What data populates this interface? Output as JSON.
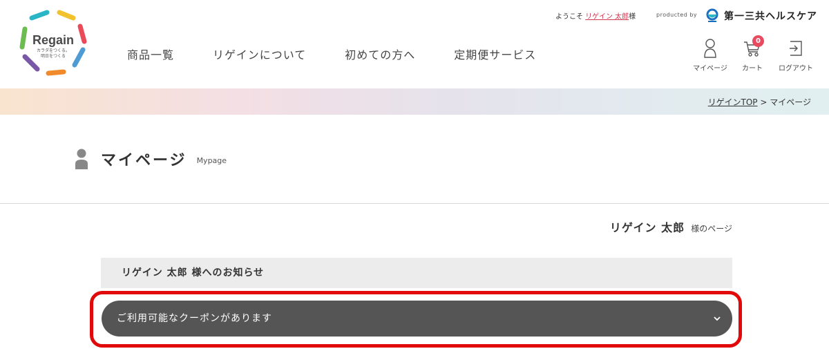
{
  "logo": {
    "name": "Regain",
    "tagline_1": "カラダをつくる。",
    "tagline_2": "明日をつくる",
    "colors": [
      "#2bb6c8",
      "#f2c12e",
      "#e94b59",
      "#f08a2a",
      "#7a58a8",
      "#4f9bd3",
      "#6cbc4f"
    ]
  },
  "header": {
    "welcome_prefix": "ようこそ",
    "welcome_user": "リゲイン 太郎",
    "welcome_suffix": "様",
    "produced_by": "producted by",
    "brand_name": "第一三共ヘルスケア"
  },
  "nav": {
    "items": [
      "商品一覧",
      "リゲインについて",
      "初めての方へ",
      "定期便サービス"
    ]
  },
  "utility": {
    "mypage": "マイページ",
    "cart": "カート",
    "cart_count": "0",
    "logout": "ログアウト"
  },
  "breadcrumb": {
    "home": "リゲインTOP",
    "separator": ">",
    "current": "マイページ"
  },
  "page": {
    "title": "マイページ",
    "subtitle": "Mypage",
    "user_name": "リゲイン 太郎",
    "user_suffix": "様のページ"
  },
  "notice": {
    "heading": "リゲイン 太郎 様へのお知らせ",
    "coupon_label": "ご利用可能なクーポンがあります"
  },
  "colors": {
    "accent_red": "#e00a0a",
    "badge": "#e84a5f",
    "bar": "#555555",
    "link": "#d2364e"
  }
}
